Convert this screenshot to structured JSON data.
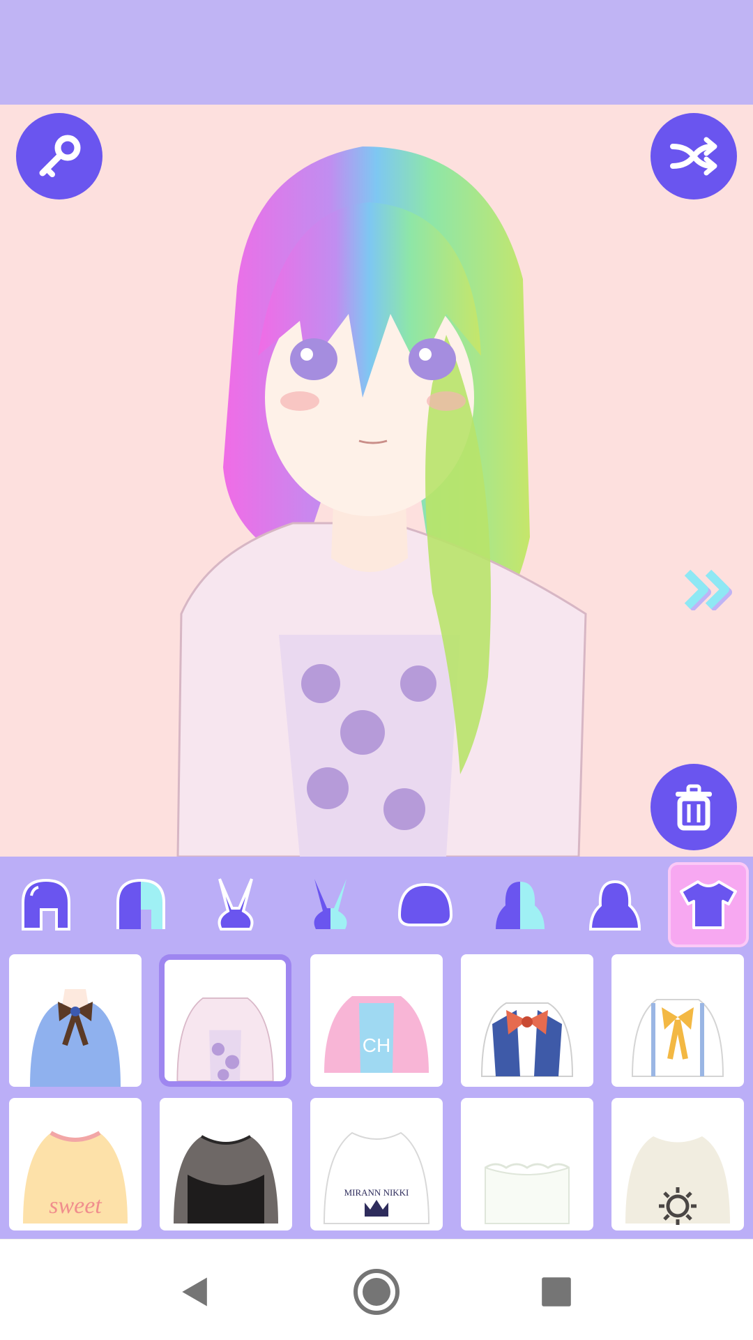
{
  "colors": {
    "top_bar": "#c0b4f4",
    "canvas_background": "#fde0de",
    "accent": "#6a55ef",
    "category_bar": "#bbaef7",
    "selected_tab": "#f7a8f1",
    "selected_item_border": "#9e86f0"
  },
  "icons": {
    "unlock": "key-icon",
    "randomize": "shuffle-icon",
    "delete": "trash-icon",
    "next": "double-chevron-right-icon"
  },
  "categories": [
    {
      "icon": "front-hair-icon"
    },
    {
      "icon": "hair-color-icon"
    },
    {
      "icon": "ears-icon"
    },
    {
      "icon": "ears-color-icon"
    },
    {
      "icon": "head-icon"
    },
    {
      "icon": "skin-color-icon"
    },
    {
      "icon": "body-icon"
    },
    {
      "icon": "top-clothing-icon",
      "selected": true
    }
  ],
  "items": [
    {
      "icon": "blue-blouse-ribbon-icon"
    },
    {
      "icon": "pink-jacket-floral-top-icon",
      "selected": true
    },
    {
      "icon": "pink-hoodie-icon"
    },
    {
      "icon": "school-uniform-red-bow-icon"
    },
    {
      "icon": "white-shirt-yellow-bow-icon"
    },
    {
      "icon": "sweet-tshirt-icon",
      "text": "sweet"
    },
    {
      "icon": "black-lace-top-icon"
    },
    {
      "icon": "crown-tshirt-icon",
      "text": "MIRANN NIKKI"
    },
    {
      "icon": "white-frill-top-icon"
    },
    {
      "icon": "beige-sun-tshirt-icon"
    }
  ],
  "system_nav": {
    "back": "back-triangle-icon",
    "home": "home-circle-icon",
    "recents": "recents-square-icon"
  }
}
